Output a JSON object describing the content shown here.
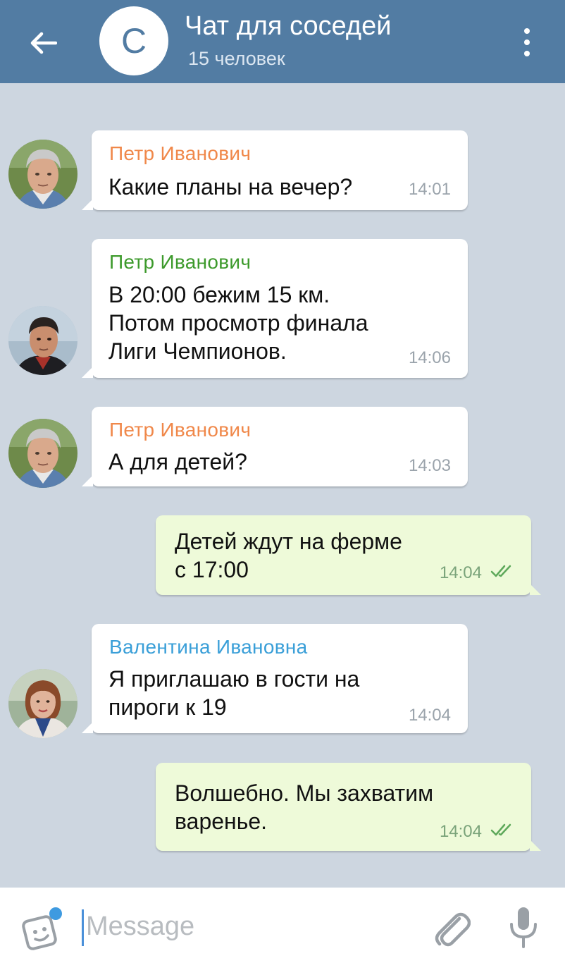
{
  "header": {
    "avatar_letter": "С",
    "title": "Чат для соседей",
    "subtitle": "15 человек"
  },
  "messages": [
    {
      "direction": "in",
      "sender": "Петр Иванович",
      "sender_color": "#f0884a",
      "text": "Какие планы на вечер?",
      "time": "14:01",
      "avatar": "grey-haired-man-photo"
    },
    {
      "direction": "in",
      "sender": "Петр Иванович",
      "sender_color": "#3d9a2c",
      "text": "В 20:00 бежим 15 км.\nПотом просмотр финала\nЛиги Чемпионов.",
      "time": "14:06",
      "avatar": "dark-haired-man-photo"
    },
    {
      "direction": "in",
      "sender": "Петр Иванович",
      "sender_color": "#f0884a",
      "text": "А для детей?",
      "time": "14:03",
      "avatar": "grey-haired-man-photo"
    },
    {
      "direction": "out",
      "text": "Детей ждут на ферме\nс 17:00",
      "time": "14:04",
      "status": "read"
    },
    {
      "direction": "in",
      "sender": "Валентина Ивановна",
      "sender_color": "#3a9fd8",
      "text": "Я приглашаю в гости на\nпироги к 19",
      "time": "14:04",
      "avatar": "woman-photo"
    },
    {
      "direction": "out",
      "text": "Волшебно. Мы захватим\nваренье.",
      "time": "14:04",
      "status": "read"
    }
  ],
  "input": {
    "placeholder": "Message",
    "icons": [
      "sticker-icon",
      "paperclip-icon",
      "microphone-icon"
    ]
  },
  "colors": {
    "header_bg": "#527ca3",
    "chat_bg": "#cdd6e0",
    "outgoing_bubble": "#eefad9",
    "incoming_bubble": "#ffffff"
  }
}
